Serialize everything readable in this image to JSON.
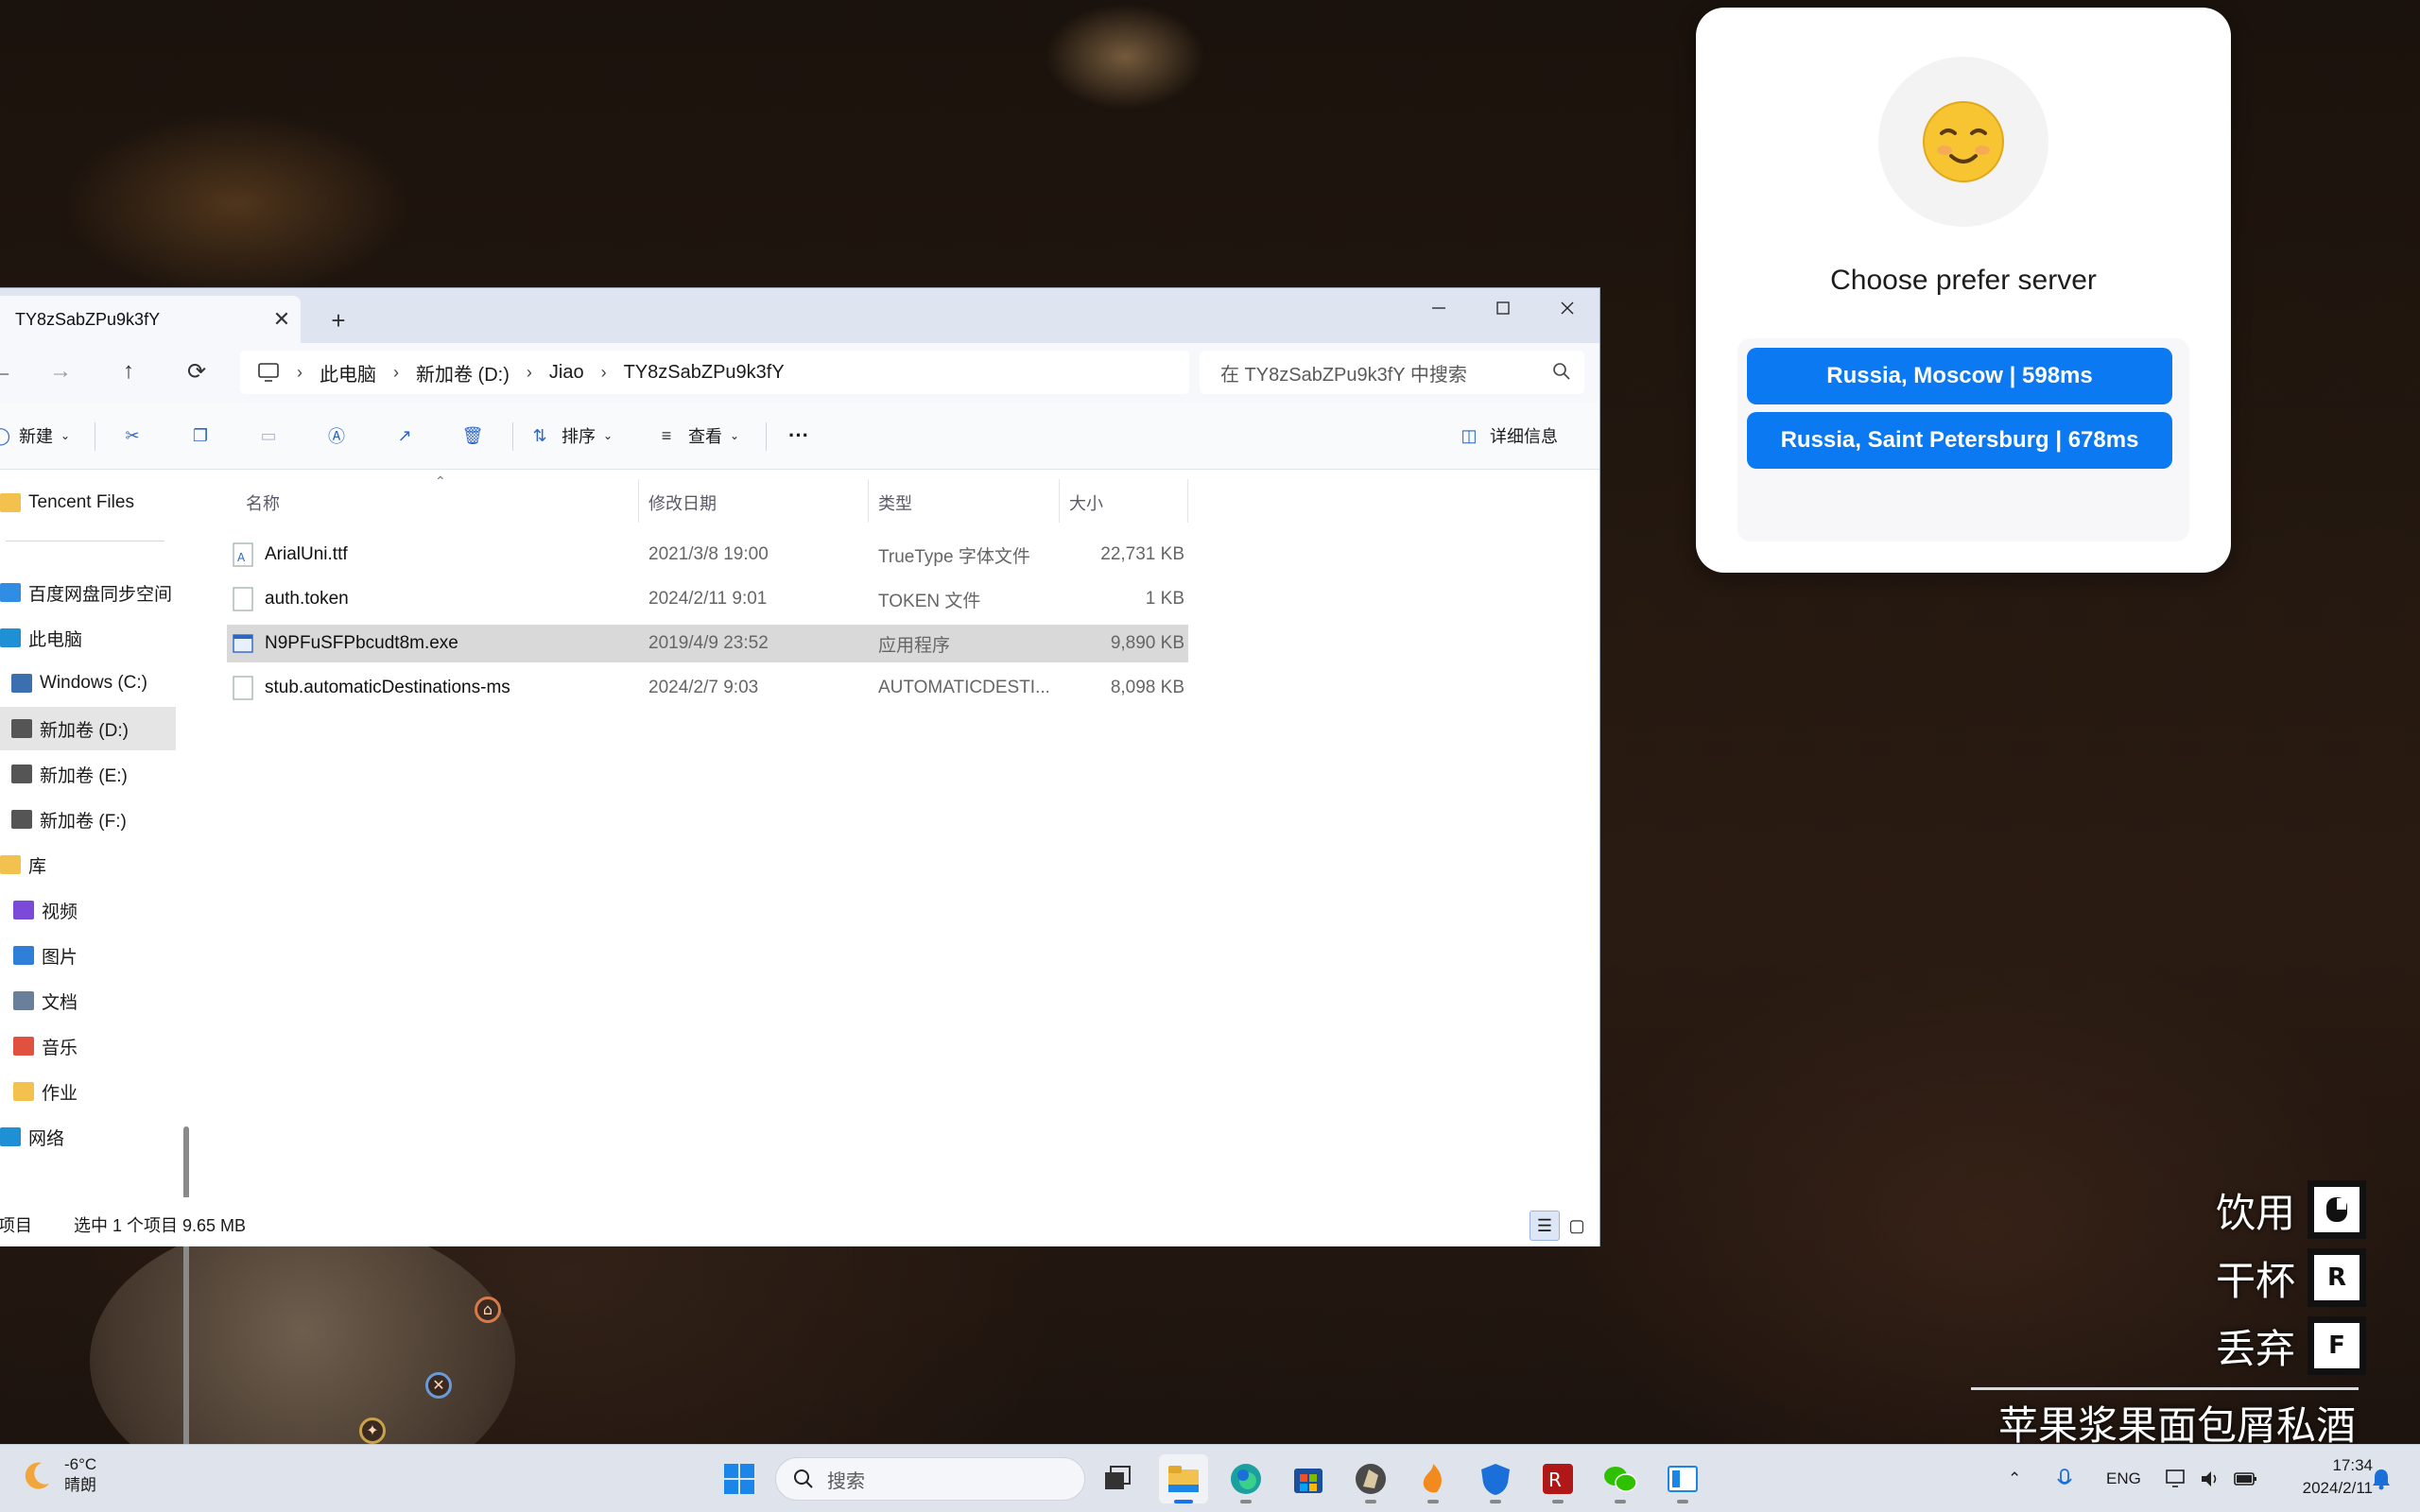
{
  "explorer": {
    "tab_title": "TY8zSabZPu9k3fY",
    "tab_close": "✕",
    "new_tab": "+",
    "breadcrumb": [
      "此电脑",
      "新加卷 (D:)",
      "Jiao",
      "TY8zSabZPu9k3fY"
    ],
    "search_placeholder": "在 TY8zSabZPu9k3fY 中搜索",
    "toolbar": {
      "new_label": "新建",
      "sort_label": "排序",
      "view_label": "查看",
      "more_label": "···",
      "details_label": "详细信息"
    },
    "sidebar": [
      {
        "label": "Tencent Files",
        "icon": "folder-icon",
        "color": "#f2c14e"
      },
      {
        "label": "百度网盘同步空间",
        "icon": "baidu-icon",
        "color": "#2f8de4"
      },
      {
        "label": "此电脑",
        "icon": "computer-icon",
        "color": "#1f8fd6"
      },
      {
        "label": "Windows (C:)",
        "icon": "drive-icon",
        "color": "#3c6fb0"
      },
      {
        "label": "新加卷 (D:)",
        "icon": "drive-icon",
        "color": "#555555"
      },
      {
        "label": "新加卷 (E:)",
        "icon": "drive-icon",
        "color": "#555555"
      },
      {
        "label": "新加卷 (F:)",
        "icon": "drive-icon",
        "color": "#555555"
      },
      {
        "label": "库",
        "icon": "library-icon",
        "color": "#f2c14e"
      },
      {
        "label": "视频",
        "icon": "video-icon",
        "color": "#7b4ad8"
      },
      {
        "label": "图片",
        "icon": "picture-icon",
        "color": "#2f7fd8"
      },
      {
        "label": "文档",
        "icon": "document-icon",
        "color": "#6a7f99"
      },
      {
        "label": "音乐",
        "icon": "music-icon",
        "color": "#e0523f"
      },
      {
        "label": "作业",
        "icon": "folder-icon",
        "color": "#f2c14e"
      },
      {
        "label": "网络",
        "icon": "network-icon",
        "color": "#1f8fd6"
      }
    ],
    "columns": {
      "name": "名称",
      "date": "修改日期",
      "type": "类型",
      "size": "大小"
    },
    "files": [
      {
        "name": "ArialUni.ttf",
        "date": "2021/3/8 19:00",
        "type": "TrueType 字体文件",
        "size": "22,731 KB",
        "icon": "font-file-icon"
      },
      {
        "name": "auth.token",
        "date": "2024/2/11 9:01",
        "type": "TOKEN 文件",
        "size": "1 KB",
        "icon": "file-icon"
      },
      {
        "name": "N9PFuSFPbcudt8m.exe",
        "date": "2019/4/9 23:52",
        "type": "应用程序",
        "size": "9,890 KB",
        "icon": "exe-file-icon"
      },
      {
        "name": "stub.automaticDestinations-ms",
        "date": "2024/2/7 9:03",
        "type": "AUTOMATICDESTI...",
        "size": "8,098 KB",
        "icon": "file-icon"
      }
    ],
    "status": {
      "items": "项目",
      "selection": "选中 1 个项目  9.65 MB"
    }
  },
  "popup": {
    "title": "Choose prefer server",
    "servers": [
      "Russia, Moscow | 598ms",
      "Russia, Saint Petersburg | 678ms"
    ]
  },
  "hud": {
    "actions": [
      {
        "label": "饮用",
        "key": ""
      },
      {
        "label": "干杯",
        "key": "R"
      },
      {
        "label": "丢弃",
        "key": "F"
      }
    ],
    "item_name": "苹果浆果面包屑私酒"
  },
  "taskbar": {
    "temperature": "-6°C",
    "condition": "晴朗",
    "search_placeholder": "搜索",
    "language": "ENG",
    "time": "17:34",
    "date": "2024/2/11"
  }
}
